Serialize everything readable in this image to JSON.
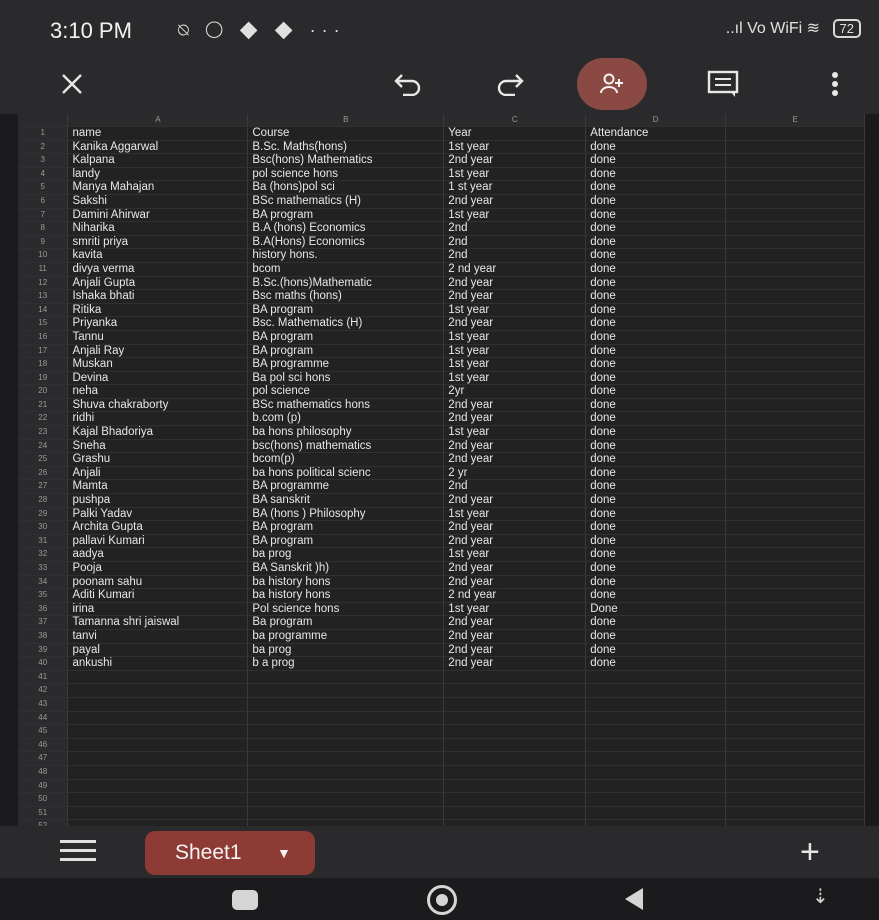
{
  "status": {
    "time": "3:10 PM",
    "icons": "⍉ ◯ ◆ ◆ ···",
    "network": "..ıl Vo WiFi ≋",
    "battery": "72"
  },
  "toolbar": {
    "close": "close",
    "undo": "undo",
    "redo": "redo",
    "share": "add-person",
    "comment": "comment",
    "more": "more"
  },
  "columns": [
    "A",
    "B",
    "C",
    "D",
    "E"
  ],
  "rows": [
    [
      "name",
      "Course",
      "Year",
      "Attendance"
    ],
    [
      "Kanika Aggarwal",
      "B.Sc. Maths(hons)",
      "1st year",
      "done"
    ],
    [
      "Kalpana",
      "Bsc(hons) Mathematics",
      "2nd year",
      "done"
    ],
    [
      "landy",
      "pol science hons",
      "1st year",
      "done"
    ],
    [
      "Manya Mahajan",
      "Ba (hons)pol sci",
      "1 st year",
      "done"
    ],
    [
      "Sakshi",
      "BSc mathematics (H)",
      "2nd year",
      "done"
    ],
    [
      "Damini Ahirwar",
      "BA program",
      "1st year",
      "done"
    ],
    [
      "Niharika",
      "B.A (hons) Economics",
      "2nd",
      "done"
    ],
    [
      "smriti priya",
      "B.A(Hons) Economics",
      "2nd",
      "done"
    ],
    [
      "kavita",
      "history hons.",
      "2nd",
      "done"
    ],
    [
      "divya verma",
      "bcom",
      "2 nd year",
      "done"
    ],
    [
      "Anjali Gupta",
      "B.Sc.(hons)Mathematic",
      "2nd year",
      "done"
    ],
    [
      "Ishaka bhati",
      "Bsc maths (hons)",
      "2nd year",
      "done"
    ],
    [
      "Ritika",
      "BA program",
      "1st year",
      "done"
    ],
    [
      "Priyanka",
      "Bsc. Mathematics (H)",
      "2nd year",
      "done"
    ],
    [
      "Tannu",
      "BA program",
      "1st year",
      "done"
    ],
    [
      "Anjali Ray",
      "BA program",
      "1st year",
      "done"
    ],
    [
      "Muskan",
      "BA programme",
      "1st year",
      "done"
    ],
    [
      "Devina",
      "Ba pol sci hons",
      "1st year",
      "done"
    ],
    [
      "neha",
      "pol science",
      "2yr",
      "done"
    ],
    [
      "Shuva chakraborty",
      "BSc mathematics hons",
      "2nd year",
      "done"
    ],
    [
      "ridhi",
      "b.com (p)",
      "2nd year",
      "done"
    ],
    [
      "Kajal Bhadoriya",
      "ba hons philosophy",
      "1st year",
      "done"
    ],
    [
      "Sneha",
      "bsc(hons) mathematics",
      "2nd year",
      "done"
    ],
    [
      "Grashu",
      "bcom(p)",
      "2nd year",
      "done"
    ],
    [
      "Anjali",
      "ba hons political scienc",
      "2 yr",
      "done"
    ],
    [
      "Mamta",
      "BA programme",
      "2nd",
      "done"
    ],
    [
      "pushpa",
      "BA sanskrit",
      "2nd year",
      "done"
    ],
    [
      "Palki Yadav",
      "BA (hons ) Philosophy",
      "1st year",
      "done"
    ],
    [
      "Archita Gupta",
      "BA program",
      "2nd year",
      "done"
    ],
    [
      "pallavi Kumari",
      "BA program",
      "2nd year",
      "done"
    ],
    [
      "aadya",
      "ba prog",
      "1st year",
      "done"
    ],
    [
      "Pooja",
      "BA Sanskrit )h)",
      "2nd year",
      "done"
    ],
    [
      "poonam sahu",
      "ba history hons",
      "2nd year",
      "done"
    ],
    [
      "Aditi Kumari",
      "ba history hons",
      "2 nd year",
      "done"
    ],
    [
      "irina",
      "Pol science hons",
      "1st year",
      "Done"
    ],
    [
      "Tamanna shri jaiswal",
      "Ba program",
      "2nd year",
      "done"
    ],
    [
      "tanvi",
      "ba programme",
      "2nd year",
      "done"
    ],
    [
      "payal",
      "ba prog",
      "2nd year",
      "done"
    ],
    [
      "ankushi",
      "b a prog",
      "2nd year",
      "done"
    ]
  ],
  "empty_row_count": 12,
  "bottom": {
    "sheet_name": "Sheet1",
    "add": "+"
  },
  "colors": {
    "accent": "#8e3b35",
    "background": "#1b1b1d",
    "toolbar": "#2a2a2c"
  }
}
